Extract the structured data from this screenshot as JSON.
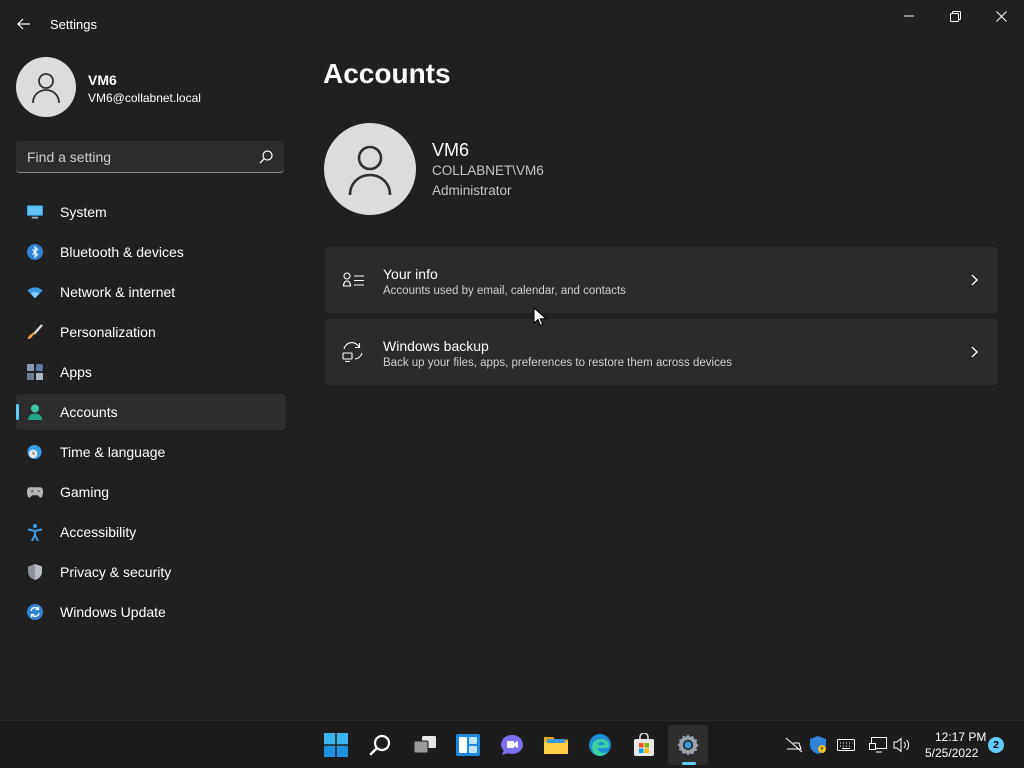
{
  "window": {
    "title": "Settings",
    "icons": {
      "back": "back-arrow-icon",
      "minimize": "minimize-icon",
      "maximize": "restore-icon",
      "close": "close-icon"
    }
  },
  "profile": {
    "name": "VM6",
    "email": "VM6@collabnet.local",
    "avatar_icon": "user-avatar-icon"
  },
  "search": {
    "placeholder": "Find a setting",
    "value": "",
    "icon": "search-icon"
  },
  "sidebar": {
    "items": [
      {
        "label": "System",
        "icon": "system-monitor-icon",
        "selected": false
      },
      {
        "label": "Bluetooth & devices",
        "icon": "bluetooth-icon",
        "selected": false
      },
      {
        "label": "Network & internet",
        "icon": "wifi-icon",
        "selected": false
      },
      {
        "label": "Personalization",
        "icon": "paintbrush-icon",
        "selected": false
      },
      {
        "label": "Apps",
        "icon": "apps-icon",
        "selected": false
      },
      {
        "label": "Accounts",
        "icon": "person-icon",
        "selected": true
      },
      {
        "label": "Time & language",
        "icon": "globe-clock-icon",
        "selected": false
      },
      {
        "label": "Gaming",
        "icon": "gamepad-icon",
        "selected": false
      },
      {
        "label": "Accessibility",
        "icon": "accessibility-icon",
        "selected": false
      },
      {
        "label": "Privacy & security",
        "icon": "shield-icon",
        "selected": false
      },
      {
        "label": "Windows Update",
        "icon": "update-sync-icon",
        "selected": false
      }
    ]
  },
  "main": {
    "title": "Accounts",
    "account": {
      "name": "VM6",
      "domain": "COLLABNET\\VM6",
      "role": "Administrator"
    },
    "cards": [
      {
        "title": "Your info",
        "subtitle": "Accounts used by email, calendar, and contacts",
        "icon": "contact-card-icon"
      },
      {
        "title": "Windows backup",
        "subtitle": "Back up your files, apps, preferences to restore them across devices",
        "icon": "backup-sync-icon"
      }
    ]
  },
  "taskbar": {
    "apps": [
      {
        "name": "start-icon",
        "active": false
      },
      {
        "name": "search-icon",
        "active": false
      },
      {
        "name": "task-view-icon",
        "active": false
      },
      {
        "name": "widgets-icon",
        "active": false
      },
      {
        "name": "teams-chat-icon",
        "active": false
      },
      {
        "name": "file-explorer-icon",
        "active": false
      },
      {
        "name": "edge-icon",
        "active": false
      },
      {
        "name": "store-icon",
        "active": false
      },
      {
        "name": "settings-gear-icon",
        "active": true
      }
    ],
    "tray": [
      "network-off-icon",
      "defender-shield-icon",
      "keyboard-icon",
      "display-icon",
      "volume-icon"
    ],
    "time": "12:17 PM",
    "date": "5/25/2022",
    "notifications": "2"
  },
  "colors": {
    "background": "#202020",
    "card": "#2b2b2b",
    "accent": "#60cdff",
    "taskbar": "#1c1c1c"
  }
}
